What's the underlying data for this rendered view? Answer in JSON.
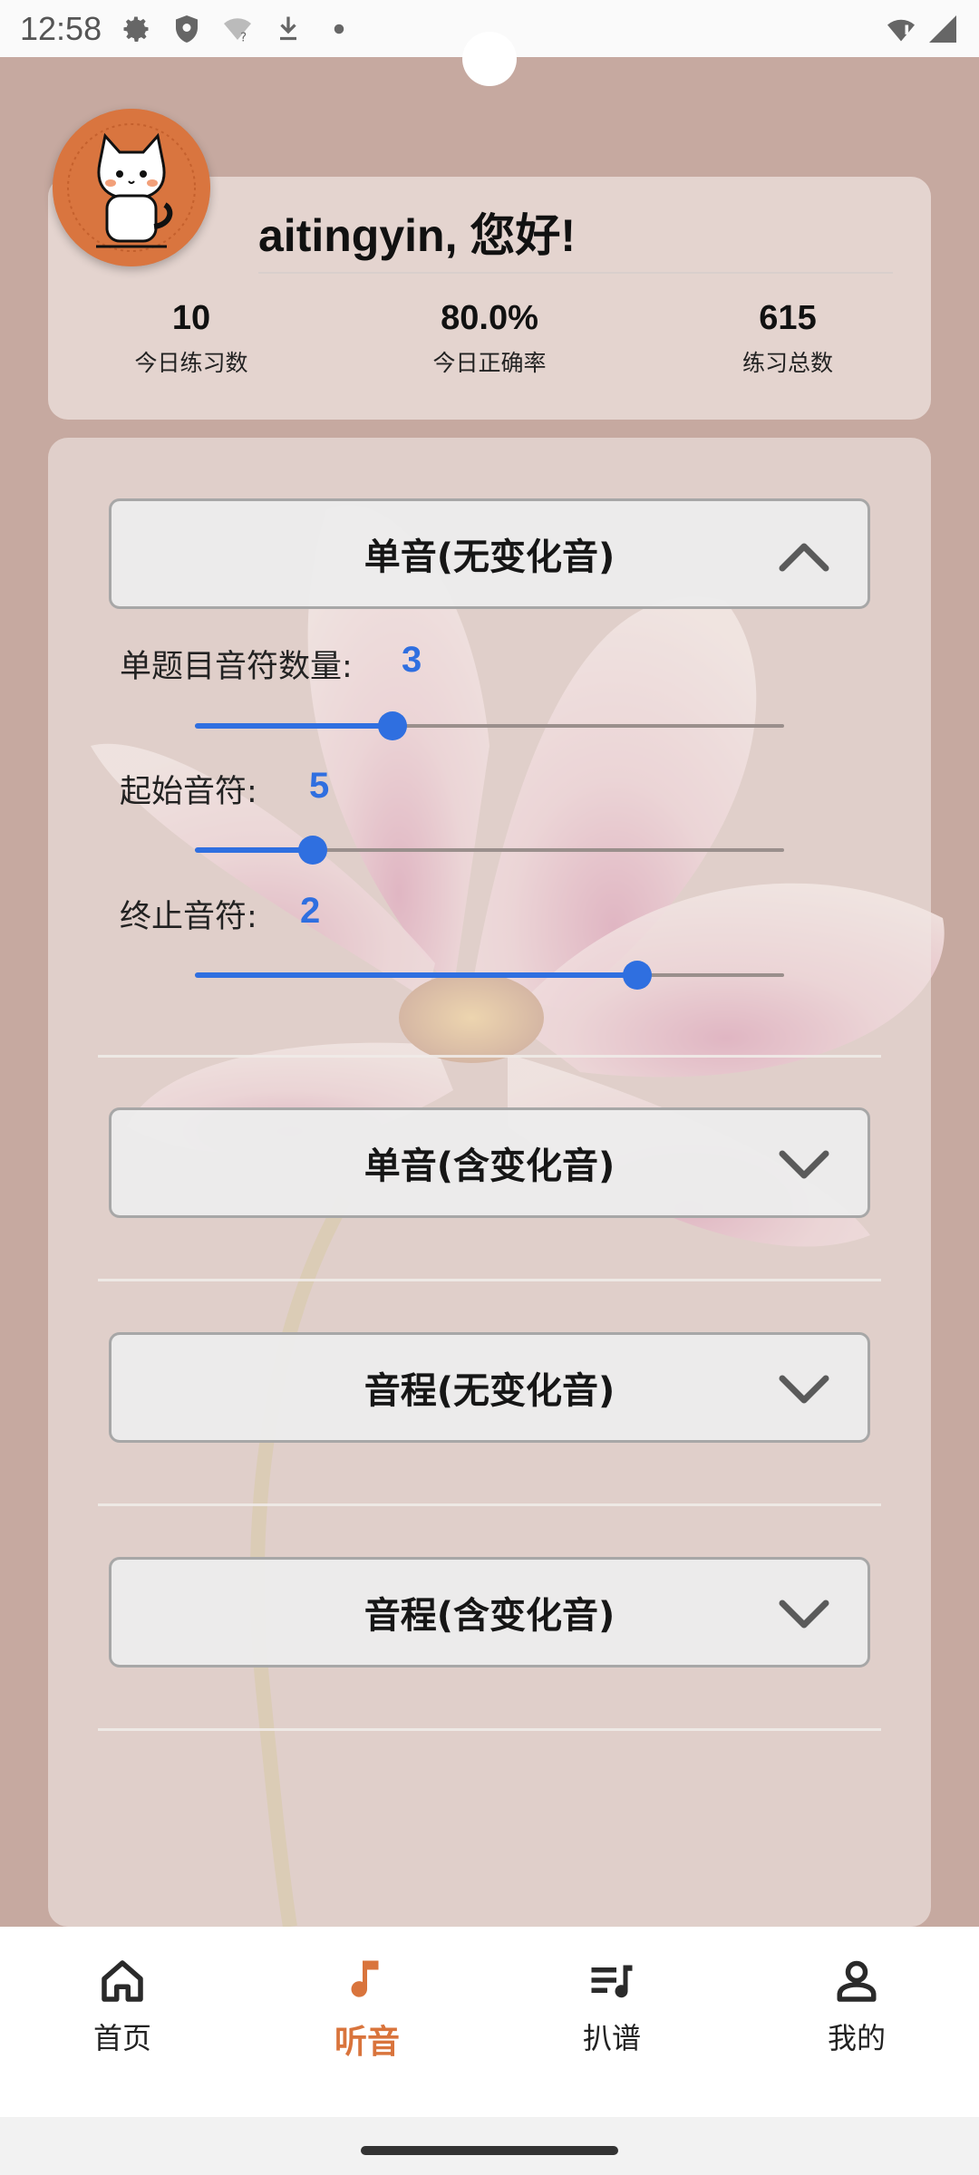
{
  "status_bar": {
    "time": "12:58",
    "icons": [
      "gear-icon",
      "shield-icon",
      "wifi-question-icon",
      "download-icon",
      "dot-icon"
    ],
    "right_icons": [
      "wifi-alert-icon",
      "signal-icon"
    ]
  },
  "profile": {
    "greeting": "aitingyin, 您好!",
    "avatar": "cat-avatar",
    "stats": [
      {
        "value": "10",
        "label": "今日练习数"
      },
      {
        "value": "80.0%",
        "label": "今日正确率"
      },
      {
        "value": "615",
        "label": "练习总数"
      }
    ]
  },
  "sections": [
    {
      "title": "单音(无变化音)",
      "expanded": true
    },
    {
      "title": "单音(含变化音)",
      "expanded": false
    },
    {
      "title": "音程(无变化音)",
      "expanded": false
    },
    {
      "title": "音程(含变化音)",
      "expanded": false
    }
  ],
  "sliders": [
    {
      "label": "单题目音符数量:",
      "value": "3",
      "fraction": 0.335
    },
    {
      "label": "起始音符:",
      "value": "5",
      "fraction": 0.2
    },
    {
      "label": "终止音符:",
      "value": "2",
      "fraction": 0.75
    }
  ],
  "bottom_nav": {
    "active_index": 1,
    "items": [
      {
        "label": "首页",
        "icon": "home-icon"
      },
      {
        "label": "听音",
        "icon": "music-note-icon"
      },
      {
        "label": "扒谱",
        "icon": "playlist-music-icon"
      },
      {
        "label": "我的",
        "icon": "person-icon"
      }
    ]
  },
  "colors": {
    "accent": "#2f6fe0",
    "nav_active": "#d9743c",
    "background": "#c6a9a0"
  }
}
